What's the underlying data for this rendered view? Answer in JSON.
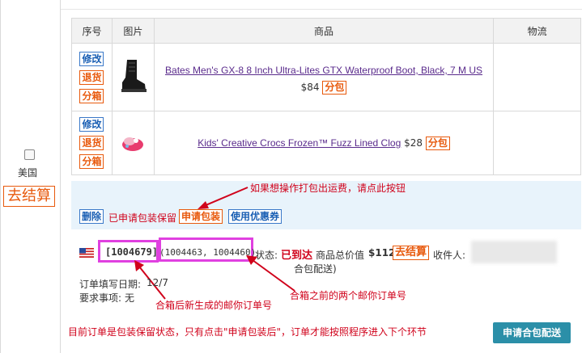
{
  "table": {
    "headers": [
      "序号",
      "图片",
      "商品",
      "物流"
    ],
    "rows": [
      {
        "ops": [
          "修改",
          "退货",
          "分箱"
        ],
        "product": "Bates Men's GX-8 8 Inch Ultra-Lites GTX Waterproof Boot, Black, 7 M US",
        "price": "$84",
        "tag": "分包"
      },
      {
        "ops": [
          "修改",
          "退货",
          "分箱"
        ],
        "product": "Kids' Creative Crocs Frozen™ Fuzz Lined Clog",
        "price": "$28",
        "tag": "分包"
      }
    ]
  },
  "left": {
    "country": "美国",
    "checkout": "去结算"
  },
  "action_bar": {
    "delete": "删除",
    "status_text": "已申请包装保留",
    "apply_pack": "申请包装",
    "use_coupon": "使用优惠券",
    "annotation": "如果想操作打包出运费，请点此按钮"
  },
  "order": {
    "new_id": "[1004679]",
    "old_ids": "(1004463, 1004460)",
    "status_label": "状态:",
    "status_value": "已到达",
    "total_label": "商品总价值",
    "total_value": "$112",
    "checkout": "去结算",
    "receiver_label": "收件人:",
    "merge_note": "合包配送)",
    "date_label": "订单填写日期:",
    "date_value": "12/7",
    "req_label": "要求事项:",
    "req_value": "无",
    "annotation_new": "合箱后新生成的邮你订单号",
    "annotation_old": "合箱之前的两个邮你订单号"
  },
  "footer": {
    "notice": "目前订单是包装保留状态，只有点击\"申请包装后\"，订单才能按照程序进入下个环节",
    "apply_merge": "申请合包配送"
  },
  "colors": {
    "annotation_red": "#d0021b",
    "highlight_pink": "#e040e0",
    "accent_orange": "#e8590c",
    "button_teal": "#2b8fa8"
  }
}
